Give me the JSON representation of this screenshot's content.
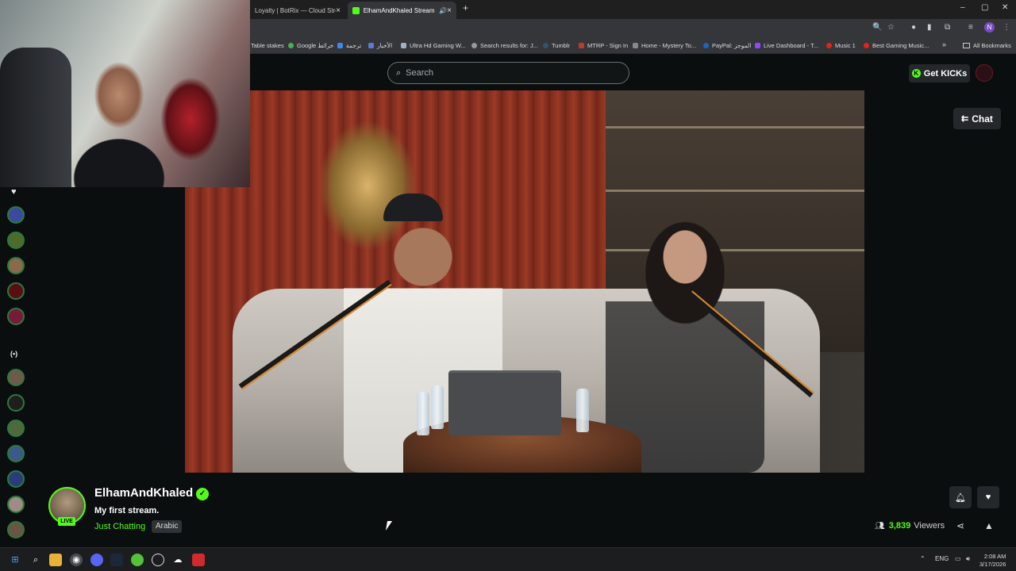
{
  "browser": {
    "tabs": [
      {
        "title": "Loyalty | BotRix — Cloud Strea",
        "close": "×"
      },
      {
        "title": "ElhamAndKhaled Stream - ",
        "close": "×"
      }
    ],
    "new_tab": "+",
    "window_controls": {
      "minimize": "–",
      "maximize": "▢",
      "close": "✕"
    },
    "profile_initial": "N",
    "bookmarks": [
      "Table stakes",
      "Google خرائط",
      "ترجمة",
      "الأخبار",
      "Ultra Hd Gaming W...",
      "Search results for: J...",
      "Tumblr",
      "MTRP - Sign In",
      "Home - Mystery To...",
      "PayPal: الموجز",
      "Live Dashboard - T...",
      "Music 1",
      "Best Gaming Music..."
    ],
    "bookmarks_overflow": "»",
    "all_bookmarks": "All Bookmarks"
  },
  "kick": {
    "search_placeholder": "Search",
    "get_kicks_label": "Get KICKs",
    "chat_button_label": "Chat"
  },
  "stream": {
    "streamer_name": "ElhamAndKhaled",
    "live_badge": "LIVE",
    "title": "My first stream.",
    "category": "Just Chatting",
    "language_tag": "Arabic",
    "viewer_count": "3,839",
    "viewer_label": "Viewers"
  },
  "sidebar": {
    "following_icon": "heart-icon",
    "live_icon": "broadcast-icon",
    "live_icon_text": "(•)"
  },
  "taskbar": {
    "tray_lang": "ENG",
    "time": "2:08 AM",
    "date": "3/17/2026"
  },
  "colors": {
    "kick_green": "#53fc18",
    "background": "#0b0e0f",
    "button_bg": "#24282b"
  }
}
